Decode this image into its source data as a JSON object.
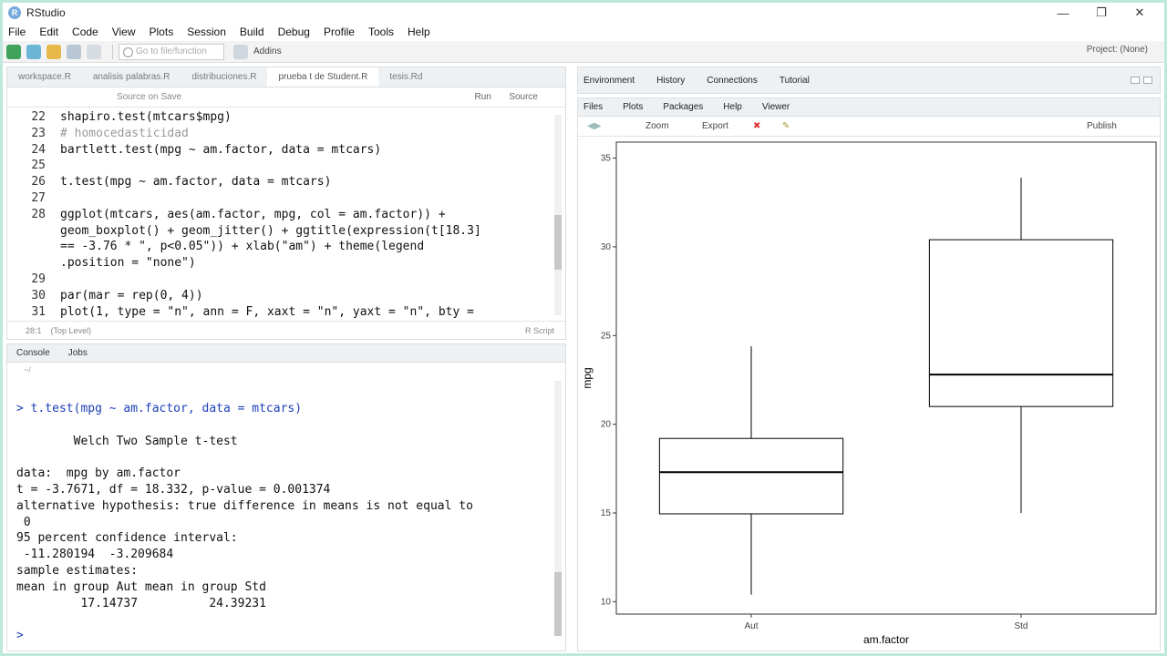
{
  "window": {
    "title": "RStudio"
  },
  "menu": [
    "File",
    "Edit",
    "Code",
    "View",
    "Plots",
    "Session",
    "Build",
    "Debug",
    "Profile",
    "Tools",
    "Help"
  ],
  "toolbar": {
    "goto_placeholder": "Go to file/function",
    "addins": "Addins",
    "project": "Project: (None)"
  },
  "editor": {
    "tabs": [
      "workspace.R",
      "analisis palabras.R",
      "distribuciones.R",
      "prueba t de Student.R",
      "tesis.Rd"
    ],
    "toolbar_left": "Source on Save",
    "toolbar_run": "Run",
    "toolbar_source": "Source",
    "lines": [
      {
        "n": "22",
        "t": "shapiro.test(mtcars$mpg)"
      },
      {
        "n": "23",
        "t": "# homocedasticidad",
        "comment": true
      },
      {
        "n": "24",
        "t": "bartlett.test(mpg ~ am.factor, data = mtcars)"
      },
      {
        "n": "25",
        "t": ""
      },
      {
        "n": "26",
        "t": "t.test(mpg ~ am.factor, data = mtcars)"
      },
      {
        "n": "27",
        "t": ""
      },
      {
        "n": "28",
        "t": "ggplot(mtcars, aes(am.factor, mpg, col = am.factor)) +"
      },
      {
        "n": "",
        "t": "geom_boxplot() + geom_jitter() + ggtitle(expression(t[18.3]"
      },
      {
        "n": "",
        "t": "== -3.76 * \", p<0.05\")) + xlab(\"am\") + theme(legend"
      },
      {
        "n": "",
        "t": ".position = \"none\")"
      },
      {
        "n": "29",
        "t": ""
      },
      {
        "n": "30",
        "t": "par(mar = rep(0, 4))"
      },
      {
        "n": "31",
        "t": "plot(1, type = \"n\", ann = F, xaxt = \"n\", yaxt = \"n\", bty ="
      }
    ],
    "status_pos": "28:1",
    "status_level": "(Top Level)",
    "status_type": "R Script"
  },
  "console": {
    "tabs": [
      "Console",
      "Jobs"
    ],
    "path": "~/",
    "lines": [
      {
        "t": "> t.test(mpg ~ am.factor, data = mtcars)",
        "prompt": true
      },
      {
        "t": ""
      },
      {
        "t": "        Welch Two Sample t-test"
      },
      {
        "t": ""
      },
      {
        "t": "data:  mpg by am.factor"
      },
      {
        "t": "t = -3.7671, df = 18.332, p-value = 0.001374"
      },
      {
        "t": "alternative hypothesis: true difference in means is not equal to"
      },
      {
        "t": " 0"
      },
      {
        "t": "95 percent confidence interval:"
      },
      {
        "t": " -11.280194  -3.209684"
      },
      {
        "t": "sample estimates:"
      },
      {
        "t": "mean in group Aut mean in group Std"
      },
      {
        "t": "         17.14737          24.39231"
      },
      {
        "t": ""
      },
      {
        "t": ">",
        "prompt": true
      }
    ]
  },
  "env_tabs": [
    "Environment",
    "History",
    "Connections",
    "Tutorial"
  ],
  "plot_tabs": [
    "Files",
    "Plots",
    "Packages",
    "Help",
    "Viewer"
  ],
  "plot_toolbar": {
    "zoom": "Zoom",
    "export": "Export",
    "publish": "Publish"
  },
  "chart_data": {
    "type": "boxplot",
    "categories": [
      "Aut",
      "Std"
    ],
    "boxes": [
      {
        "category": "Aut",
        "min": 10.4,
        "q1": 14.95,
        "median": 17.3,
        "q3": 19.2,
        "max": 24.4
      },
      {
        "category": "Std",
        "min": 15.0,
        "q1": 21.0,
        "median": 22.8,
        "q3": 30.4,
        "max": 33.9
      }
    ],
    "xlabel": "am.factor",
    "ylabel": "mpg",
    "ylim": [
      9.3,
      35.9
    ],
    "yticks": [
      10,
      15,
      20,
      25,
      30,
      35
    ],
    "colors": {
      "box": "#000000",
      "background": "#ffffff"
    }
  }
}
